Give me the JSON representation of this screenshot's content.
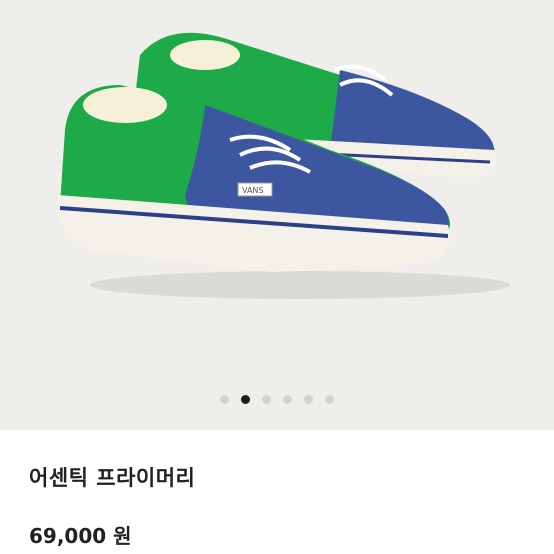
{
  "product": {
    "title": "어센틱 프라이머리",
    "price": "69,000 원",
    "image_description_icon": "sneaker-photo",
    "brand_tag": "VANS"
  },
  "carousel": {
    "total": 6,
    "active_index": 1
  },
  "colors": {
    "green_canvas": "#1faa4a",
    "blue_suede": "#3d56a0",
    "sole_white": "#f4f1e8",
    "sole_stripe": "#2e3f8a"
  }
}
